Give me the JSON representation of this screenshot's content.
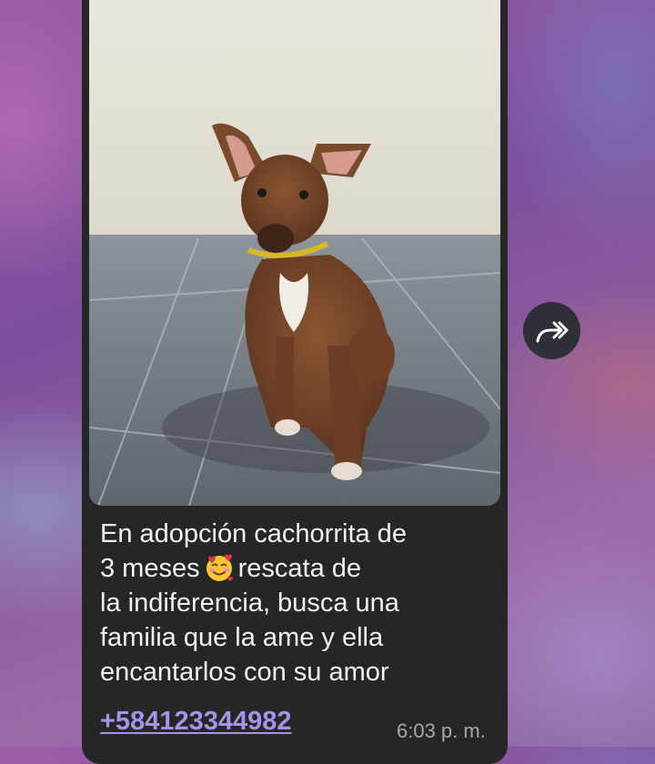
{
  "message": {
    "caption_line1": "En adopción cachorrita de",
    "caption_line2a": "3 meses",
    "caption_emoji": "smiling-face-with-hearts-icon",
    "caption_line2b": "rescata de",
    "caption_line3": "la indiferencia, busca una",
    "caption_line4": "familia que la ame y ella",
    "caption_line5": "encantarlos con su amor",
    "phone": "+584123344982",
    "time": "6:03 p. m."
  },
  "forward_button": {
    "icon": "forward-arrow-icon"
  },
  "colors": {
    "bubble": "#262626",
    "link": "#a991e8",
    "time": "#a8a8a8",
    "text": "#f2f2f2"
  }
}
